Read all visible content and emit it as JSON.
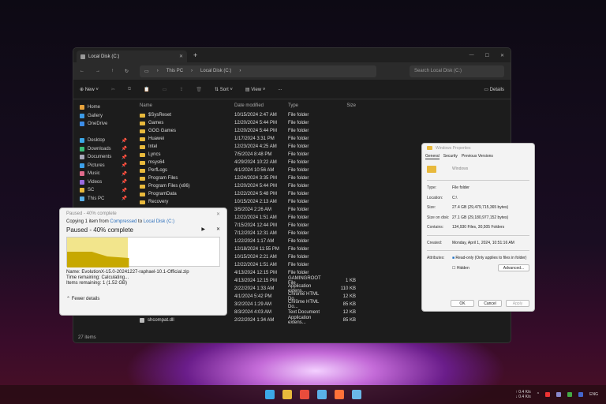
{
  "explorer": {
    "tab_title": "Local Disk (C:)",
    "breadcrumb": [
      "This PC",
      "Local Disk (C:)"
    ],
    "search_placeholder": "Search Local Disk (C:)",
    "toolbar": {
      "new": "New",
      "sort": "Sort",
      "view": "View",
      "more": "...",
      "details": "Details"
    },
    "nav": [
      {
        "label": "Home",
        "color": "#e8a33c"
      },
      {
        "label": "Gallery",
        "color": "#3c9be8"
      },
      {
        "label": "OneDrive",
        "color": "#3c8de8"
      },
      {
        "label": "",
        "color": ""
      },
      {
        "label": "Desktop",
        "color": "#3ca8e8",
        "pin": true
      },
      {
        "label": "Downloads",
        "color": "#3cc07a",
        "pin": true
      },
      {
        "label": "Documents",
        "color": "#aab",
        "pin": true
      },
      {
        "label": "Pictures",
        "color": "#3ca0e8",
        "pin": true
      },
      {
        "label": "Music",
        "color": "#e06b8c",
        "pin": true
      },
      {
        "label": "Videos",
        "color": "#9b6be0",
        "pin": true
      },
      {
        "label": "SC",
        "color": "#e8b93c",
        "pin": true
      },
      {
        "label": "This PC",
        "color": "#5ab0e8",
        "pin": true
      }
    ],
    "columns": [
      "Name",
      "Date modified",
      "Type",
      "Size"
    ],
    "rows": [
      [
        "$SysReset",
        "10/15/2024 2:47 AM",
        "File folder",
        ""
      ],
      [
        "Games",
        "12/20/2024 5:44 PM",
        "File folder",
        ""
      ],
      [
        "GOG Games",
        "12/20/2024 5:44 PM",
        "File folder",
        ""
      ],
      [
        "Huawei",
        "1/17/2024 3:31 PM",
        "File folder",
        ""
      ],
      [
        "Intel",
        "12/23/2024 4:25 AM",
        "File folder",
        ""
      ],
      [
        "Lyncs",
        "7/5/2024 8:48 PM",
        "File folder",
        ""
      ],
      [
        "msys64",
        "4/29/2024 10:22 AM",
        "File folder",
        ""
      ],
      [
        "PerfLogs",
        "4/1/2024 10:56 AM",
        "File folder",
        ""
      ],
      [
        "Program Files",
        "12/24/2024 3:35 PM",
        "File folder",
        ""
      ],
      [
        "Program Files (x86)",
        "12/20/2024 5:44 PM",
        "File folder",
        ""
      ],
      [
        "ProgramData",
        "12/22/2024 5:48 PM",
        "File folder",
        ""
      ],
      [
        "Recovery",
        "10/15/2024 2:13 AM",
        "File folder",
        ""
      ],
      [
        "",
        "3/5/2024 2:26 AM",
        "File folder",
        ""
      ],
      [
        "",
        "12/22/2024 1:51 AM",
        "File folder",
        ""
      ],
      [
        "",
        "7/15/2024 12:44 PM",
        "File folder",
        ""
      ],
      [
        "",
        "7/12/2024 12:31 AM",
        "File folder",
        ""
      ],
      [
        "",
        "1/22/2024 1:17 AM",
        "File folder",
        ""
      ],
      [
        "",
        "12/18/2024 11:55 PM",
        "File folder",
        ""
      ],
      [
        "",
        "10/15/2024 2:21 AM",
        "File folder",
        ""
      ],
      [
        "",
        "12/22/2024 1:51 AM",
        "File folder",
        ""
      ],
      [
        "",
        "4/13/2024 12:15 PM",
        "File folder",
        ""
      ],
      [
        "",
        "4/13/2024 12:15 PM",
        "GAMINGROOT File",
        "1 KB"
      ],
      [
        "",
        "2/22/2024 1:33 AM",
        "Application extens...",
        "110 KB"
      ],
      [
        "",
        "4/1/2024 5:42 PM",
        "Chrome HTML Do...",
        "12 KB"
      ],
      [
        "",
        "3/2/2024 1:29 AM",
        "Chrome HTML Do...",
        "85 KB"
      ],
      [
        "",
        "8/3/2024 4:03 AM",
        "Text Document",
        "12 KB"
      ],
      [
        "shcompat.dll",
        "2/22/2024 1:34 AM",
        "Application extens...",
        "85 KB"
      ]
    ],
    "status": "27 items"
  },
  "copy": {
    "title": "Paused - 40% complete",
    "from_prefix": "Copying 1 item from",
    "source": "Compressed",
    "to": "to",
    "dest": "Local Disk (C:)",
    "heading": "Paused - 40% complete",
    "progress": 40,
    "name": "Name: EvolutionX-15.0-20241227-raphael-10.1-Official.zip",
    "time": "Time remaining: Calculating...",
    "items": "Items remaining: 1 (1.52 GB)",
    "fewer": "Fewer details"
  },
  "props": {
    "title": "Windows Properties",
    "tabs": [
      "General",
      "Security",
      "Previous Versions"
    ],
    "name": "Windows",
    "fields": [
      [
        "Type:",
        "File folder"
      ],
      [
        "Location:",
        "C:\\"
      ],
      [
        "Size:",
        "27.4 GB (29,479,715,365 bytes)"
      ],
      [
        "Size on disk:",
        "27.1 GB (29,180,977,152 bytes)"
      ],
      [
        "Contains:",
        "134,930 Files, 30,505 Folders"
      ]
    ],
    "created_label": "Created:",
    "created": "Monday, April 1, 2024, 10:51:16 AM",
    "attr_label": "Attributes:",
    "readonly": "Read-only (Only applies to files in folder)",
    "hidden": "Hidden",
    "advanced": "Advanced...",
    "ok": "OK",
    "cancel": "Cancel",
    "apply": "Apply"
  },
  "taskbar": {
    "apps": [
      {
        "name": "start",
        "color": "#3ca8e8"
      },
      {
        "name": "file-explorer",
        "color": "#e8b93c"
      },
      {
        "name": "chrome",
        "color": "#e84c3c"
      },
      {
        "name": "notepad",
        "color": "#5ab0e8"
      },
      {
        "name": "firefox",
        "color": "#ff7139"
      },
      {
        "name": "remote-desktop",
        "color": "#6ab8e8"
      }
    ],
    "net_up": "↑ 0.4 K/s",
    "net_down": "↓ 0.4 K/s",
    "lang": "ENG"
  }
}
